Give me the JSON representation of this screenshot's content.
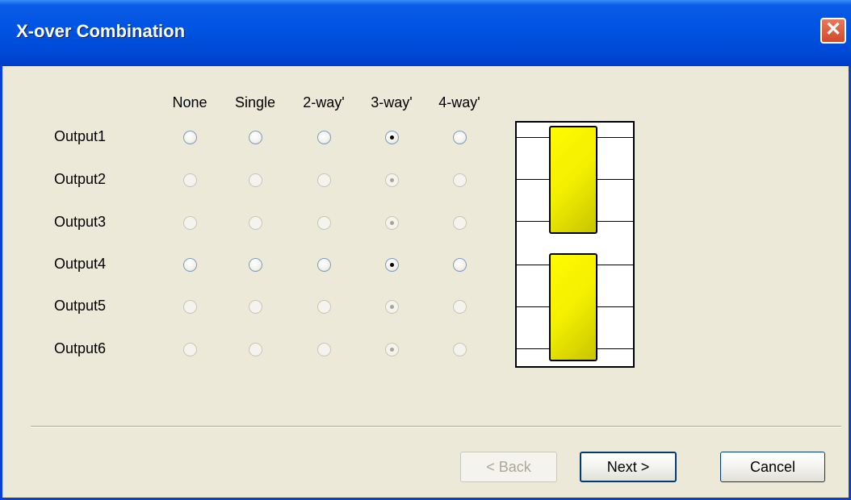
{
  "window": {
    "title": "X-over Combination",
    "close_glyph": "✕"
  },
  "columns": [
    "None",
    "Single",
    "2-way'",
    "3-way'",
    "4-way'"
  ],
  "outputs": [
    {
      "label": "Output1",
      "selected": "3-way'",
      "enabled": true
    },
    {
      "label": "Output2",
      "selected": "3-way'",
      "enabled": false
    },
    {
      "label": "Output3",
      "selected": "3-way'",
      "enabled": false
    },
    {
      "label": "Output4",
      "selected": "3-way'",
      "enabled": true
    },
    {
      "label": "Output5",
      "selected": "3-way'",
      "enabled": false
    },
    {
      "label": "Output6",
      "selected": "3-way'",
      "enabled": false
    }
  ],
  "buttons": {
    "back": {
      "label": "< Back",
      "enabled": false
    },
    "next": {
      "label": "Next >",
      "enabled": true
    },
    "cancel": {
      "label": "Cancel",
      "enabled": true
    }
  },
  "colors": {
    "title_bar": "#0054e3",
    "block_fill": "#f3ef00",
    "dialog_bg": "#ece9d8"
  }
}
